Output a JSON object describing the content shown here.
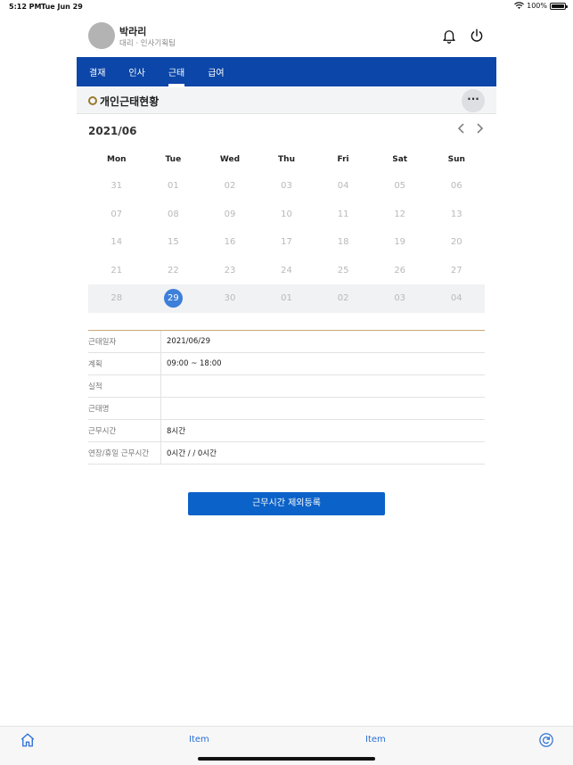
{
  "status_bar": {
    "time": "5:12 PM",
    "date": "Tue Jun 29",
    "battery": "100%"
  },
  "profile": {
    "name": "박라리",
    "dept": "대리 · 인사기획팀"
  },
  "tabs": [
    {
      "label": "결재",
      "active": false
    },
    {
      "label": "인사",
      "active": false
    },
    {
      "label": "근태",
      "active": true
    },
    {
      "label": "급여",
      "active": false
    }
  ],
  "section": {
    "title": "개인근태현황",
    "more": "···"
  },
  "calendar": {
    "month": "2021/06",
    "weekdays": [
      "Mon",
      "Tue",
      "Wed",
      "Thu",
      "Fri",
      "Sat",
      "Sun"
    ],
    "weeks": [
      [
        "31",
        "01",
        "02",
        "03",
        "04",
        "05",
        "06"
      ],
      [
        "07",
        "08",
        "09",
        "10",
        "11",
        "12",
        "13"
      ],
      [
        "14",
        "15",
        "16",
        "17",
        "18",
        "19",
        "20"
      ],
      [
        "21",
        "22",
        "23",
        "24",
        "25",
        "26",
        "27"
      ],
      [
        "28",
        "29",
        "30",
        "01",
        "02",
        "03",
        "04"
      ]
    ],
    "selected": "29"
  },
  "info_rows": [
    {
      "key": "근태일자",
      "value": "2021/06/29"
    },
    {
      "key": "계획",
      "value": "09:00 ~ 18:00"
    },
    {
      "key": "실적",
      "value": ""
    },
    {
      "key": "근태명",
      "value": ""
    },
    {
      "key": "근무시간",
      "value": "8시간"
    },
    {
      "key": "연장/휴일 근무시간",
      "value": "0시간 / / 0시간"
    }
  ],
  "button": {
    "label": "근무시간 제외등록"
  },
  "bottom_bar": {
    "item1": "Item",
    "item2": "Item"
  },
  "colors": {
    "primary": "#0b46a8",
    "button": "#0b62c8",
    "today": "#3d7fd9",
    "accent_ring": "#9a7b2f"
  }
}
